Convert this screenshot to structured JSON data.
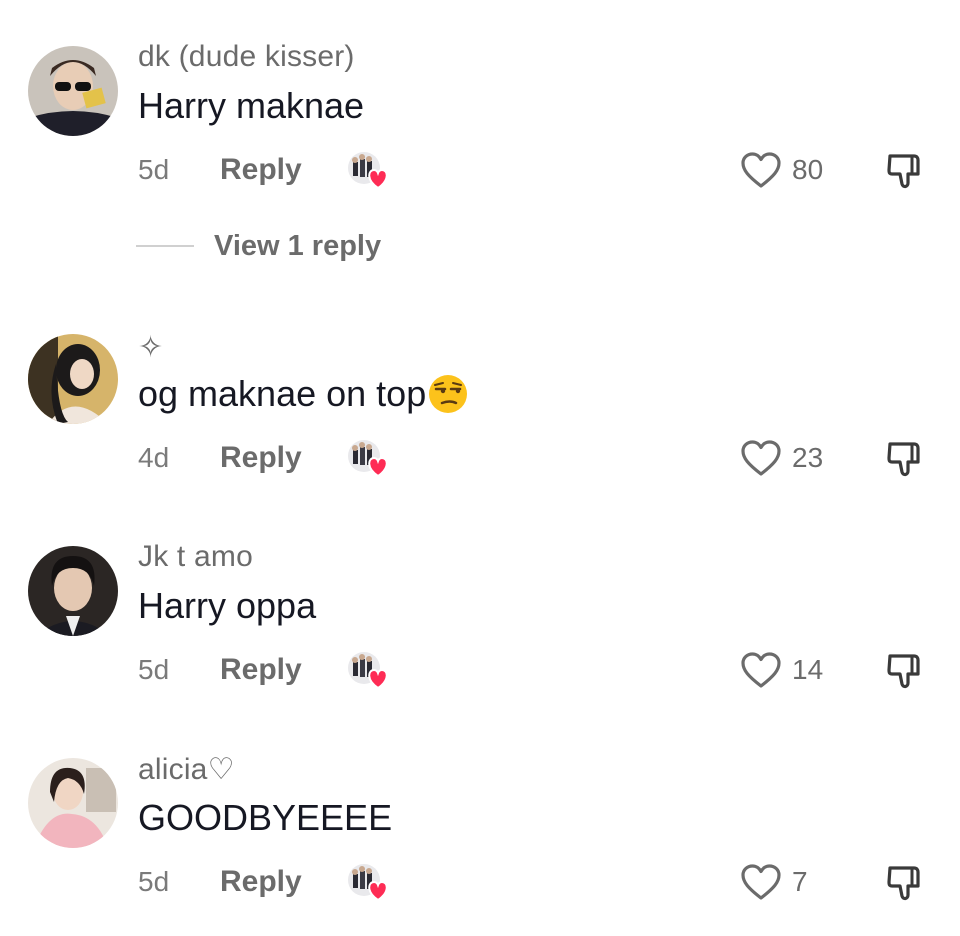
{
  "comments": [
    {
      "username": "dk (dude kisser)",
      "text": "Harry maknae",
      "time": "5d",
      "reply_label": "Reply",
      "likes": "80",
      "view_replies": "View 1 reply"
    },
    {
      "username": "✧",
      "text": "og maknae on top",
      "emoji": "unamused-face",
      "time": "4d",
      "reply_label": "Reply",
      "likes": "23"
    },
    {
      "username": "Jk t amo",
      "text": "Harry oppa",
      "time": "5d",
      "reply_label": "Reply",
      "likes": "14"
    },
    {
      "username": "alicia♡",
      "text": "GOODBYEEEE",
      "time": "5d",
      "reply_label": "Reply",
      "likes": "7"
    }
  ],
  "icons": {
    "like": "heart-outline-icon",
    "dislike": "thumbs-down-icon",
    "creator_liked": "creator-liked-heart-icon"
  },
  "colors": {
    "text_primary": "#161823",
    "text_secondary": "#6b6b6b",
    "creator_heart": "#fe2c55"
  }
}
